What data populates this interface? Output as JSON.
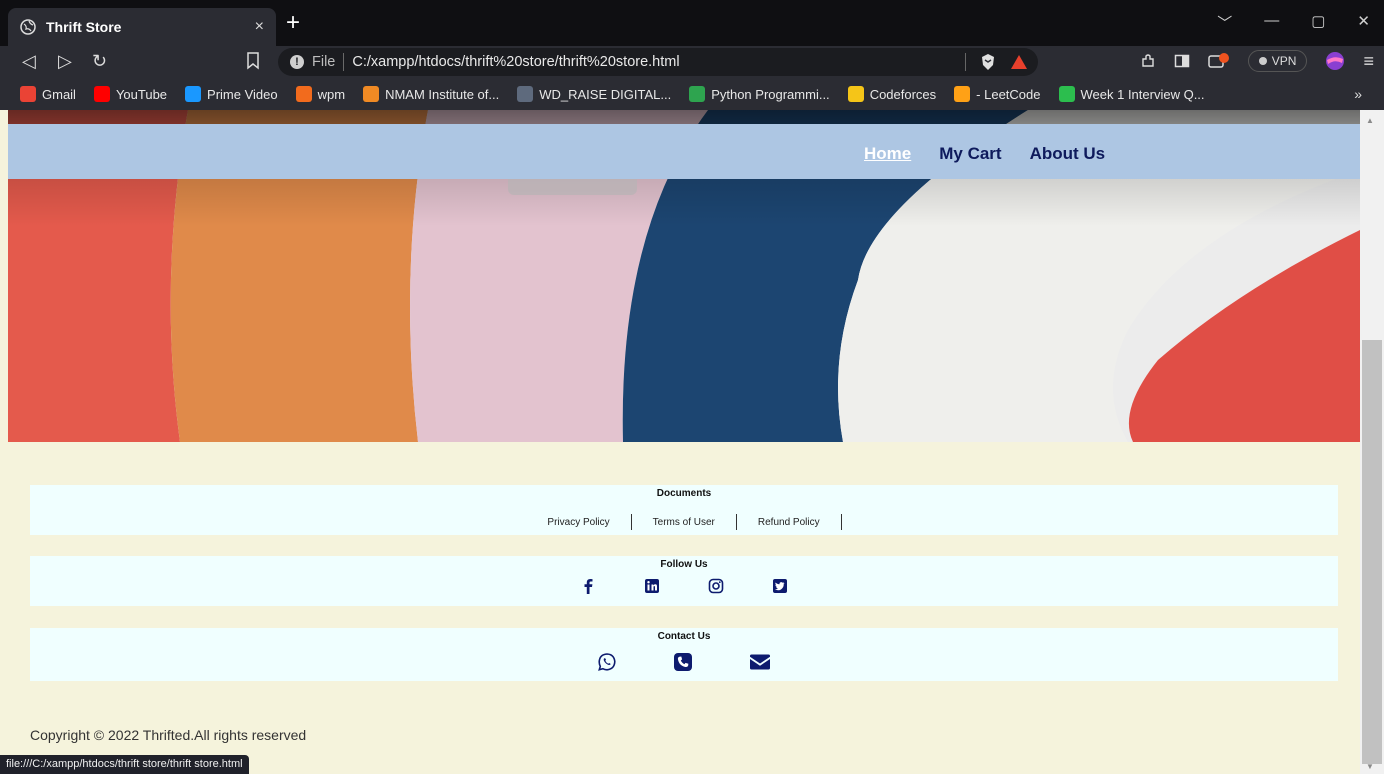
{
  "browser": {
    "tab_title": "Thrift Store",
    "tab_close": "×",
    "new_tab": "+",
    "url_prefix": "File",
    "url": "C:/xampp/htdocs/thrift%20store/thrift%20store.html",
    "vpn_label": "VPN",
    "bookmarks_more": "»",
    "bookmarks": [
      {
        "label": "Gmail",
        "color": "#ea4335"
      },
      {
        "label": "YouTube",
        "color": "#ff0000"
      },
      {
        "label": "Prime Video",
        "color": "#1a98ff"
      },
      {
        "label": "wpm",
        "color": "#f26b1d"
      },
      {
        "label": "NMAM Institute of...",
        "color": "#f08a24"
      },
      {
        "label": "WD_RAISE DIGITAL...",
        "color": "#5e6a7d"
      },
      {
        "label": "Python Programmi...",
        "color": "#2ea44f"
      },
      {
        "label": "Codeforces",
        "color": "#f5c518"
      },
      {
        "label": "- LeetCode",
        "color": "#ffa116"
      },
      {
        "label": "Week 1 Interview Q...",
        "color": "#2cbe4e"
      }
    ],
    "status_url": "file:///C:/xampp/htdocs/thrift store/thrift store.html"
  },
  "nav": {
    "home": "Home",
    "cart": "My Cart",
    "about": "About Us"
  },
  "footer": {
    "documents": {
      "title": "Documents",
      "links": [
        "Privacy Policy",
        "Terms of User",
        "Refund Policy"
      ]
    },
    "follow": {
      "title": "Follow Us",
      "icons": [
        "facebook-icon",
        "linkedin-icon",
        "instagram-icon",
        "twitter-icon"
      ]
    },
    "contact": {
      "title": "Contact Us",
      "icons": [
        "whatsapp-icon",
        "phone-icon",
        "email-icon"
      ]
    },
    "copyright": "Copyright © 2022 Thrifted.All rights reserved"
  },
  "colors": {
    "page_bg": "#f5f3dc",
    "navbar_bg": "#adc6e3",
    "nav_link": "#0e1a5c",
    "footer_box": "#f0ffff",
    "icon_blue": "#0d1b6e"
  }
}
